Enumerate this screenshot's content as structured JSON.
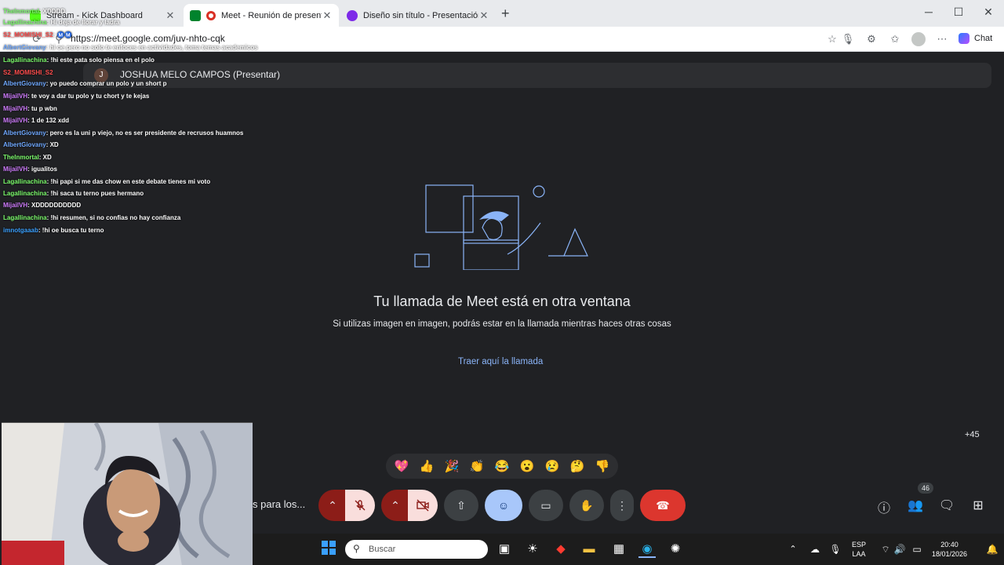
{
  "browser": {
    "tabs": [
      {
        "title": "Stream - Kick Dashboard",
        "active": false
      },
      {
        "title": "Meet - Reunión de presentación",
        "active": true
      },
      {
        "title": "Diseño sin título - Presentación",
        "active": false
      }
    ],
    "new_tab_label": "+",
    "url": "https://meet.google.com/juv-nhto-cqk",
    "chat_label": "Chat"
  },
  "meet": {
    "presenter_initial": "J",
    "presenter_name": "JOSHUA MELO CAMPOS (Presentar)",
    "title": "Tu llamada de Meet está en otra ventana",
    "subtitle": "Si utilizas imagen en imagen, podrás estar en la llamada mientras haces otras cosas",
    "link": "Traer aquí la llamada",
    "more_participants": "+45",
    "meeting_name": "s para los...",
    "participants_badge": "46",
    "reactions": [
      "💖",
      "👍",
      "🎉",
      "👏",
      "😂",
      "😮",
      "😢",
      "🤔",
      "👎"
    ]
  },
  "chat_overlay": [
    {
      "user": "TheInmortal",
      "text": ": XDDDD",
      "color": "#7cfc6c"
    },
    {
      "user": "Lagallinachina",
      "text": ": Hi deja de llorar y ladra",
      "color": "#7cfc6c"
    },
    {
      "user": "S2_MOMISHI_S2",
      "text": ": Ⓜ️Ⓜ️ ",
      "color": "#ff4d4d"
    },
    {
      "user": "AlbertGiovany",
      "text": ": hi oe pero no solo te enfoces en actividades, toma temas academicos",
      "color": "#6fa8ff"
    },
    {
      "user": "Lagallinachina",
      "text": ": !hi este pata solo piensa en el polo",
      "color": "#7cfc6c"
    },
    {
      "user": "S2_MOMISHI_S2",
      "text": "",
      "color": "#ff4d4d"
    },
    {
      "user": "AlbertGiovany",
      "text": ": yo puedo comprar un polo y un short p",
      "color": "#6fa8ff"
    },
    {
      "user": "MijailVH",
      "text": ": te voy a dar tu polo y tu chort y te kejas",
      "color": "#d07cff"
    },
    {
      "user": "MijailVH",
      "text": ": tu p wbn",
      "color": "#d07cff"
    },
    {
      "user": "MijailVH",
      "text": ": 1 de 132 xdd",
      "color": "#d07cff"
    },
    {
      "user": "AlbertGiovany",
      "text": ": pero es la uni p viejo, no es ser presidente de recrusos huamnos",
      "color": "#6fa8ff"
    },
    {
      "user": "AlbertGiovany",
      "text": ": XD",
      "color": "#6fa8ff"
    },
    {
      "user": "TheInmortal",
      "text": ": XD",
      "color": "#7cfc6c"
    },
    {
      "user": "MijailVH",
      "text": ": igualitos",
      "color": "#d07cff"
    },
    {
      "user": "Lagallinachina",
      "text": ": !hi papi si me das chow en este debate tienes mi voto",
      "color": "#7cfc6c"
    },
    {
      "user": "Lagallinachina",
      "text": ": !hi saca tu terno pues hermano",
      "color": "#7cfc6c"
    },
    {
      "user": "MijailVH",
      "text": ": XDDDDDDDDDD",
      "color": "#d07cff"
    },
    {
      "user": "Lagallinachina",
      "text": ": !hi resumen, si no confias no hay confianza",
      "color": "#7cfc6c"
    },
    {
      "user": "imnotgaaab",
      "text": ": !hi oe busca tu terno",
      "color": "#3aa0ff"
    }
  ],
  "taskbar": {
    "search_placeholder": "Buscar",
    "lang_top": "ESP",
    "lang_bottom": "LAA",
    "time": "20:40",
    "date": "18/01/2026"
  },
  "icons": {
    "reload": "reload-icon",
    "star": "star-icon",
    "mic": "mic-icon",
    "camera": "camera-icon",
    "present": "present-icon",
    "emoji": "emoji-icon",
    "captions": "captions-icon",
    "hand": "raise-hand-icon",
    "more": "more-vert-icon",
    "hangup": "hangup-icon",
    "info": "info-icon",
    "people": "people-icon",
    "chat": "chat-icon",
    "apps": "apps-icon"
  },
  "colors": {
    "meet_bg": "#202124",
    "accent_blue": "#8ab4f8",
    "hangup_red": "#dc362e"
  }
}
